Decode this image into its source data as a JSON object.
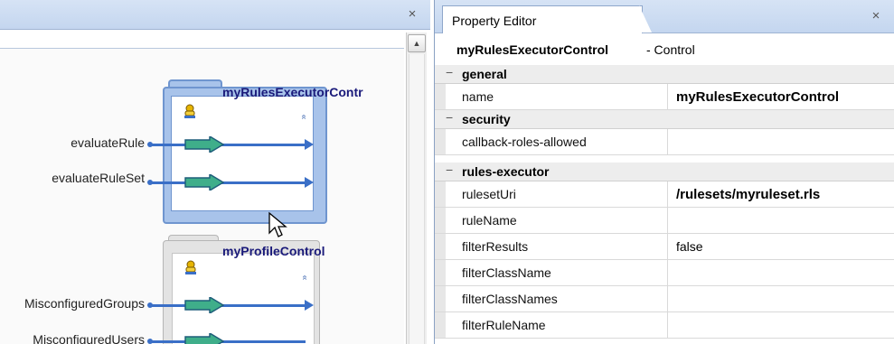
{
  "left_panel": {
    "close_glyph": "×",
    "scroll_up_glyph": "▲",
    "controls": [
      {
        "title": "myRulesExecutorContr",
        "icon": "bell-control-icon",
        "collapse_glyph": "«",
        "operations": [
          "evaluateRule",
          "evaluateRuleSet"
        ]
      },
      {
        "title": "myProfileControl",
        "icon": "bell-control-icon",
        "collapse_glyph": "«",
        "operations": [
          "MisconfiguredGroups",
          "MisconfiguredUsers"
        ]
      }
    ]
  },
  "property_editor": {
    "tab_label": "Property Editor",
    "close_glyph": "×",
    "title_name": "myRulesExecutorControl",
    "title_type": " - Control",
    "categories": [
      {
        "label": "general",
        "rows": [
          {
            "name": "name",
            "value": "myRulesExecutorControl",
            "bold": true
          }
        ]
      },
      {
        "label": "security",
        "rows": [
          {
            "name": "callback-roles-allowed",
            "value": "",
            "bold": false
          }
        ]
      },
      {
        "label": "rules-executor",
        "rows": [
          {
            "name": "rulesetUri",
            "value": "/rulesets/myruleset.rls",
            "bold": true
          },
          {
            "name": "ruleName",
            "value": "",
            "bold": false
          },
          {
            "name": "filterResults",
            "value": "false",
            "bold": false
          },
          {
            "name": "filterClassName",
            "value": "",
            "bold": false
          },
          {
            "name": "filterClassNames",
            "value": "",
            "bold": false
          },
          {
            "name": "filterRuleName",
            "value": "",
            "bold": false
          }
        ]
      }
    ]
  },
  "colors": {
    "link": "#3a6fc7",
    "selected_frame": "#a8c3ea",
    "title_text": "#1a1a7a"
  }
}
